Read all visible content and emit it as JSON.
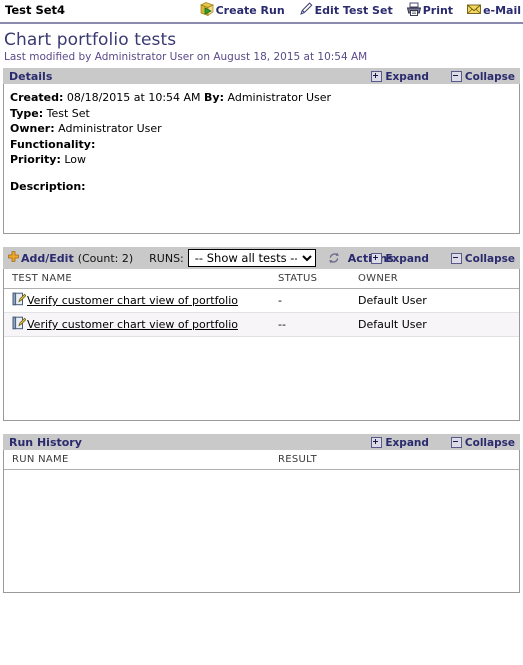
{
  "window": {
    "title": "Test Set4"
  },
  "toolbar": {
    "items": [
      {
        "label": "Create Run",
        "icon": "create-run-icon"
      },
      {
        "label": "Edit Test Set",
        "icon": "pencil-icon"
      },
      {
        "label": "Print",
        "icon": "printer-icon"
      },
      {
        "label": "e-Mail",
        "icon": "envelope-icon"
      }
    ]
  },
  "page": {
    "title": "Chart portfolio tests",
    "subtitle": "Last modified by Administrator User on August 18, 2015 at 10:54 AM"
  },
  "common": {
    "expand_label": "Expand",
    "collapse_label": "Collapse"
  },
  "details": {
    "header": "Details",
    "fields": [
      {
        "label": "Created:",
        "value": "08/18/2015 at 10:54 AM",
        "label2": "By:",
        "value2": "Administrator User"
      },
      {
        "label": "Type:",
        "value": "Test Set"
      },
      {
        "label": "Owner:",
        "value": "Administrator User"
      },
      {
        "label": "Functionality:",
        "value": ""
      },
      {
        "label": "Priority:",
        "value": "Low"
      },
      {
        "label": "Description:",
        "value": ""
      }
    ]
  },
  "tests": {
    "add_edit_label": "Add/Edit",
    "count_label": "(Count: 2)",
    "runs_label": "RUNS:",
    "runs_selected": "-- Show all tests --",
    "runs_options": [
      "-- Show all tests --"
    ],
    "actions_label": "Actions",
    "columns": [
      "TEST NAME",
      "STATUS",
      "OWNER"
    ],
    "rows": [
      {
        "name": "Verify customer chart view of portfolio",
        "status": "-",
        "owner": "Default User"
      },
      {
        "name": "Verify customer chart view of portfolio",
        "status": "--",
        "owner": "Default User"
      }
    ]
  },
  "run_history": {
    "header": "Run History",
    "columns": [
      "RUN NAME",
      "RESULT"
    ],
    "rows": []
  },
  "colors": {
    "header_bar": "#c9c9c9",
    "link": "#2a2a6e",
    "title": "#3a3a72",
    "subtitle": "#5a4a8a",
    "accent_rule": "#8a8ab0"
  }
}
